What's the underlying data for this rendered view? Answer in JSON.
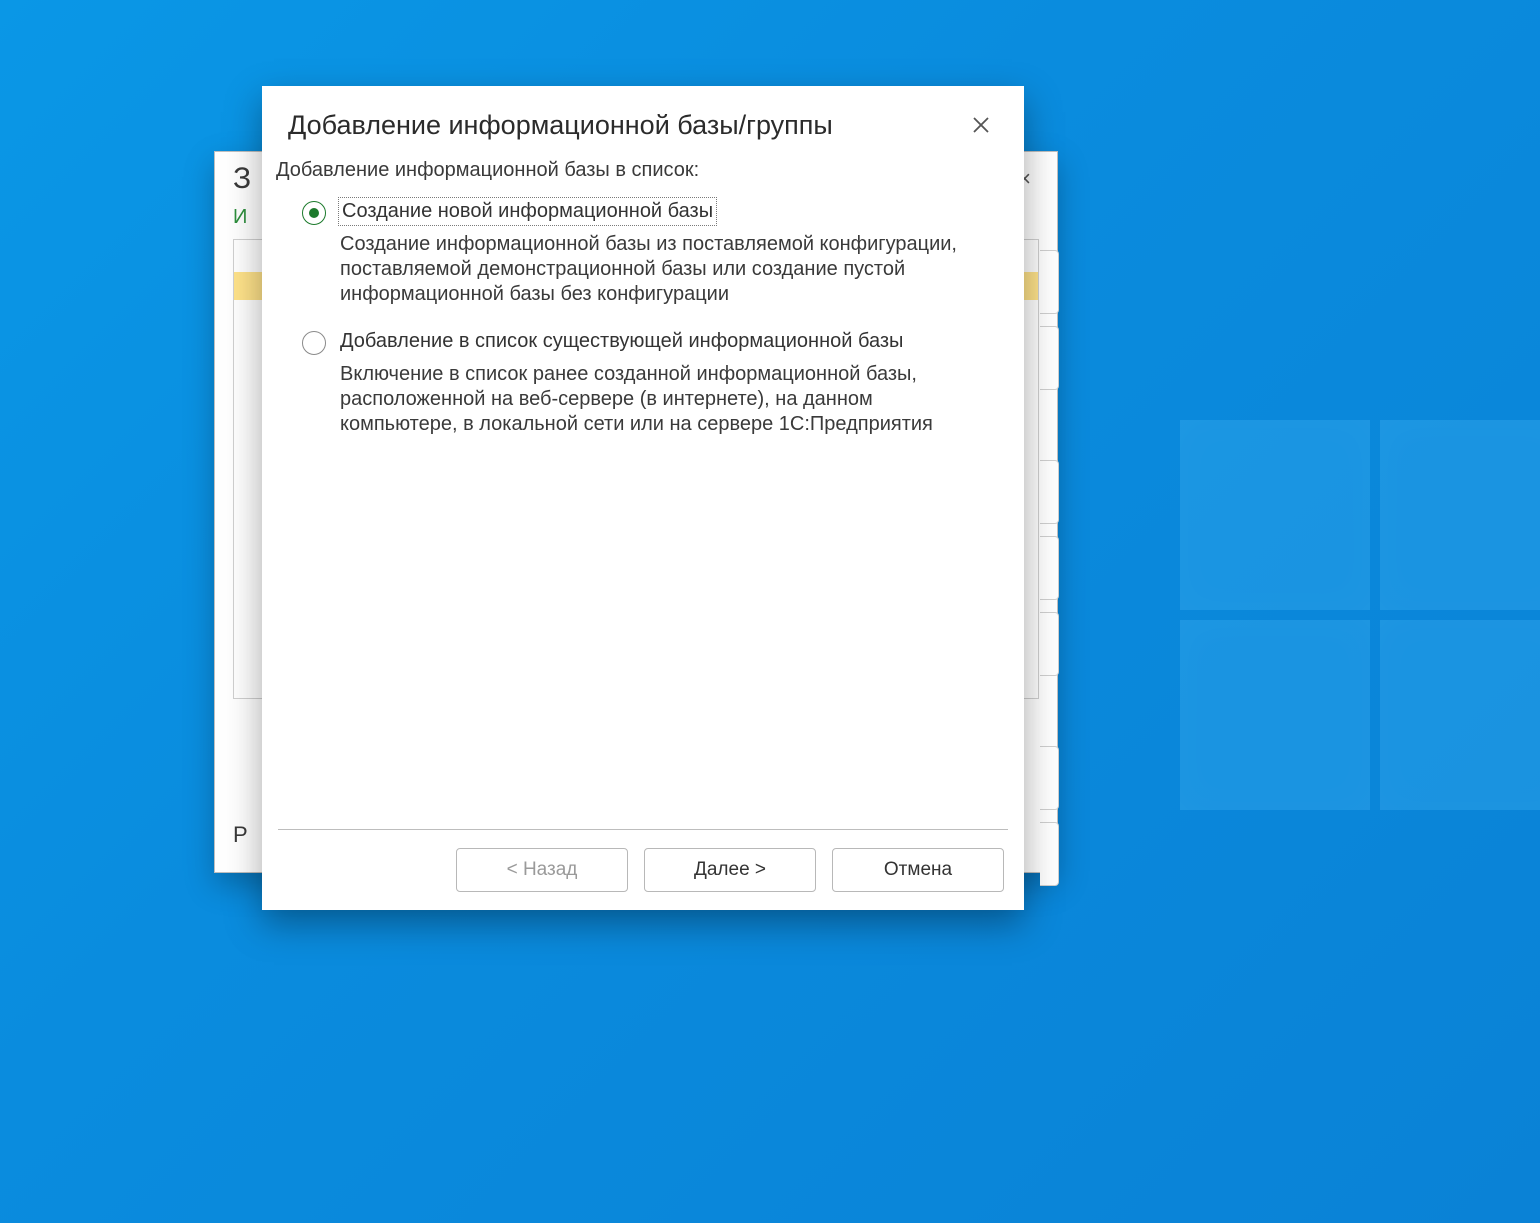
{
  "bgWindow": {
    "titleInitial": "З",
    "closeGlyph": "×",
    "subInitial": "И",
    "footerInitial": "Р"
  },
  "modal": {
    "title": "Добавление информационной базы/группы",
    "prompt": "Добавление информационной базы в список:",
    "options": [
      {
        "label": "Создание новой информационной базы",
        "description": "Создание информационной базы из поставляемой конфигурации, поставляемой демонстрационной базы или создание пустой информационной базы без конфигурации",
        "selected": true
      },
      {
        "label": "Добавление в список существующей информационной базы",
        "description": "Включение в список ранее созданной информационной базы, расположенной на веб-сервере (в интернете), на данном компьютере,  в локальной сети или на сервере 1С:Предприятия",
        "selected": false
      }
    ],
    "buttons": {
      "back": "< Назад",
      "next": "Далее >",
      "cancel": "Отмена"
    }
  }
}
